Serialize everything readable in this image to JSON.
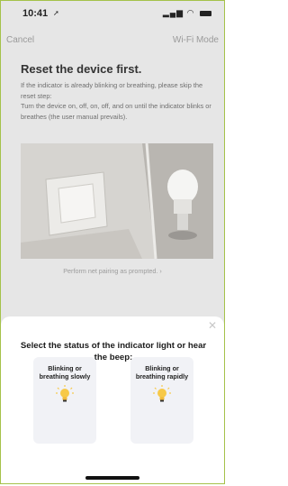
{
  "status_bar": {
    "time": "10:41"
  },
  "nav": {
    "cancel": "Cancel",
    "mode": "Wi-Fi Mode"
  },
  "main": {
    "title": "Reset the device first.",
    "instructions_line1": "If the indicator is already blinking or breathing, please skip the reset step:",
    "instructions_line2": "Turn the device on, off, on, off, and on until the indicator blinks or breathes (the user manual prevails).",
    "pairing_link": "Perform net pairing as prompted. ›"
  },
  "sheet": {
    "title": "Select the status of the indicator light or hear the beep:",
    "options": [
      {
        "label": "Blinking or breathing slowly"
      },
      {
        "label": "Blinking or breathing rapidly"
      }
    ]
  },
  "colors": {
    "frame_border": "#a5c24a",
    "bulb_yellow": "#f7c948",
    "sheet_bg": "#ffffff",
    "option_bg": "#f1f2f6"
  }
}
